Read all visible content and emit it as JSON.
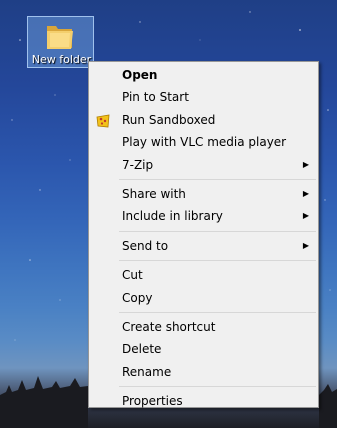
{
  "desktop": {
    "icon_label": "New folder"
  },
  "menu": {
    "groups": [
      [
        {
          "label": "Open",
          "bold": true
        },
        {
          "label": "Pin to Start"
        },
        {
          "label": "Run Sandboxed",
          "icon": "sandboxie-icon"
        },
        {
          "label": "Play with VLC media player"
        },
        {
          "label": "7-Zip",
          "submenu": true
        }
      ],
      [
        {
          "label": "Share with",
          "submenu": true
        },
        {
          "label": "Include in library",
          "submenu": true
        }
      ],
      [
        {
          "label": "Send to",
          "submenu": true
        }
      ],
      [
        {
          "label": "Cut"
        },
        {
          "label": "Copy"
        }
      ],
      [
        {
          "label": "Create shortcut"
        },
        {
          "label": "Delete"
        },
        {
          "label": "Rename"
        }
      ],
      [
        {
          "label": "Properties"
        }
      ]
    ],
    "submenu_arrow": "▶"
  },
  "colors": {
    "menu_bg": "#f0f0f0",
    "menu_border": "#979797",
    "separator": "#d7d7d7",
    "selection_bg": "#78aae6"
  }
}
